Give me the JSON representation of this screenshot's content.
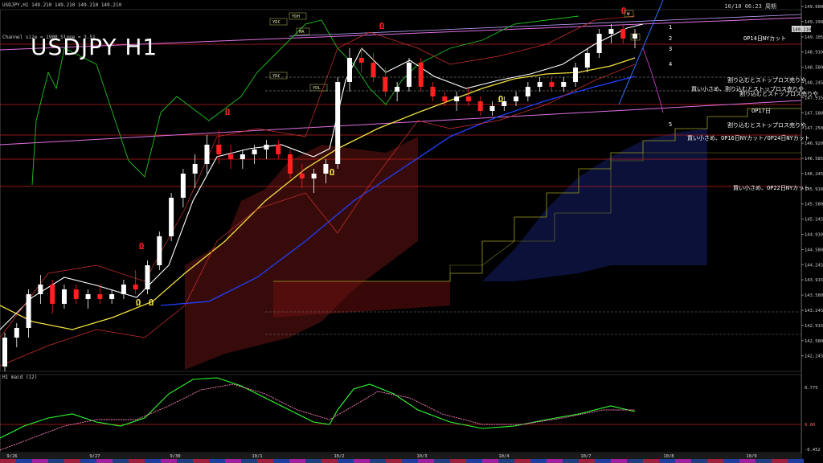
{
  "header": {
    "symbol_line": "USDJPY,H1  149.210 149.210 149.210 149.210",
    "channel_line": "Channel size = 1900 Slope = 3.51",
    "clock": "10/10 06:23 周期"
  },
  "main_title": "USDJPY H1",
  "osc": {
    "title": "H1  macd (12)",
    "levels": [
      "0.775",
      "0.00",
      "-0.452"
    ]
  },
  "price_axis": [
    "149.600",
    "149.290",
    "149.105",
    "148.910",
    "148.580",
    "148.245",
    "147.915",
    "147.580",
    "147.250",
    "146.920",
    "146.585",
    "146.245",
    "145.910",
    "145.580",
    "145.245",
    "144.910",
    "144.580",
    "144.245",
    "143.915",
    "143.580",
    "143.245",
    "142.915",
    "142.580",
    "142.245"
  ],
  "current_price": "149.210",
  "date_axis": [
    "9/26",
    "9/27",
    "9/30",
    "10/1",
    "10/2",
    "10/3",
    "10/4",
    "10/7",
    "10/8",
    "10/9"
  ],
  "right_labels": [
    {
      "text": "OP14日NYカット",
      "c": "#ffffff"
    },
    {
      "text": "割り込むとストップロス売りや",
      "c": "#ffffff"
    },
    {
      "text": "買い小さめ、割り込むとストップロス売りや",
      "c": "#ffffff"
    },
    {
      "text": "割り込むとストップロス売りや",
      "c": "#ffffff"
    },
    {
      "text": "OP17日",
      "c": "#ffffff"
    },
    {
      "text": "割り込むとストップロス売りや",
      "c": "#ffffff"
    },
    {
      "text": "買い小さめ、OP16日NYカット/OP24日NYカット",
      "c": "#ffffff"
    },
    {
      "text": "買い小さめ、OP22日NYカット",
      "c": "#ffffff"
    }
  ],
  "box_labels": [
    "YDH",
    "YDC",
    "YDC",
    "YDL",
    "MA",
    "W",
    "D"
  ],
  "wave_labels": [
    "1",
    "2",
    "3",
    "4",
    "5"
  ],
  "colors": {
    "bg": "#000000",
    "up": "#ffffff",
    "down": "#ff2020",
    "ma_yellow": "#f0e040",
    "ma_blue": "#2040ff",
    "ma_white": "#ffffff",
    "chikou": "#20c020",
    "kumo_red": "#a02020",
    "kumo_blue": "#2030a0",
    "macd": "#30ff30",
    "signal": "#ff80c0"
  },
  "chart_data": {
    "type": "candlestick",
    "symbol": "USDJPY",
    "timeframe": "H1",
    "x": [
      "9/26",
      "9/27",
      "9/30",
      "10/1",
      "10/2",
      "10/3",
      "10/4",
      "10/7",
      "10/8",
      "10/9"
    ],
    "ylim": [
      142.2,
      149.7
    ],
    "ohlc_approx": [
      [
        142.3,
        143.0,
        142.2,
        142.9
      ],
      [
        142.9,
        143.2,
        142.7,
        143.1
      ],
      [
        143.1,
        143.9,
        142.9,
        143.8
      ],
      [
        143.8,
        144.2,
        143.6,
        144.0
      ],
      [
        144.0,
        144.1,
        143.4,
        143.6
      ],
      [
        143.6,
        144.0,
        143.5,
        143.9
      ],
      [
        143.9,
        144.0,
        143.6,
        143.7
      ],
      [
        143.7,
        143.9,
        143.5,
        143.8
      ],
      [
        143.8,
        144.0,
        143.6,
        143.7
      ],
      [
        143.7,
        143.9,
        143.6,
        143.8
      ],
      [
        143.8,
        144.1,
        143.7,
        144.0
      ],
      [
        144.0,
        144.3,
        143.8,
        143.9
      ],
      [
        143.9,
        144.5,
        143.8,
        144.4
      ],
      [
        144.4,
        145.1,
        144.3,
        145.0
      ],
      [
        145.0,
        145.9,
        144.9,
        145.8
      ],
      [
        145.8,
        146.4,
        145.6,
        146.3
      ],
      [
        146.3,
        146.7,
        146.0,
        146.5
      ],
      [
        146.5,
        147.1,
        146.3,
        146.9
      ],
      [
        146.9,
        147.2,
        146.5,
        146.7
      ],
      [
        146.7,
        146.9,
        146.4,
        146.6
      ],
      [
        146.6,
        146.8,
        146.4,
        146.7
      ],
      [
        146.7,
        146.9,
        146.5,
        146.8
      ],
      [
        146.8,
        147.0,
        146.6,
        146.9
      ],
      [
        146.9,
        147.0,
        146.6,
        146.7
      ],
      [
        146.7,
        146.8,
        146.2,
        146.3
      ],
      [
        146.3,
        146.5,
        146.0,
        146.2
      ],
      [
        146.2,
        146.4,
        145.9,
        146.3
      ],
      [
        146.3,
        146.6,
        146.1,
        146.5
      ],
      [
        146.5,
        148.3,
        146.4,
        148.2
      ],
      [
        148.2,
        148.9,
        148.0,
        148.7
      ],
      [
        148.7,
        148.9,
        148.4,
        148.6
      ],
      [
        148.6,
        148.8,
        148.2,
        148.3
      ],
      [
        148.3,
        148.5,
        147.9,
        148.0
      ],
      [
        148.0,
        148.2,
        147.8,
        148.1
      ],
      [
        148.1,
        148.7,
        148.0,
        148.6
      ],
      [
        148.6,
        148.7,
        148.0,
        148.1
      ],
      [
        148.1,
        148.2,
        147.8,
        147.9
      ],
      [
        147.9,
        148.0,
        147.7,
        147.8
      ],
      [
        147.8,
        148.0,
        147.6,
        147.9
      ],
      [
        147.9,
        148.1,
        147.7,
        147.8
      ],
      [
        147.8,
        147.9,
        147.5,
        147.6
      ],
      [
        147.6,
        147.8,
        147.5,
        147.7
      ],
      [
        147.7,
        147.9,
        147.6,
        147.8
      ],
      [
        147.8,
        148.0,
        147.7,
        147.9
      ],
      [
        147.9,
        148.2,
        147.8,
        148.1
      ],
      [
        148.1,
        148.3,
        148.0,
        148.2
      ],
      [
        148.2,
        148.3,
        148.0,
        148.1
      ],
      [
        148.1,
        148.3,
        148.0,
        148.2
      ],
      [
        148.2,
        148.6,
        148.1,
        148.5
      ],
      [
        148.5,
        148.9,
        148.4,
        148.8
      ],
      [
        148.8,
        149.3,
        148.7,
        149.2
      ],
      [
        149.2,
        149.4,
        149.0,
        149.3
      ],
      [
        149.3,
        149.4,
        149.0,
        149.1
      ],
      [
        149.1,
        149.3,
        148.9,
        149.2
      ]
    ],
    "series": [
      {
        "name": "macd",
        "type": "line"
      },
      {
        "name": "signal",
        "type": "line"
      }
    ]
  }
}
